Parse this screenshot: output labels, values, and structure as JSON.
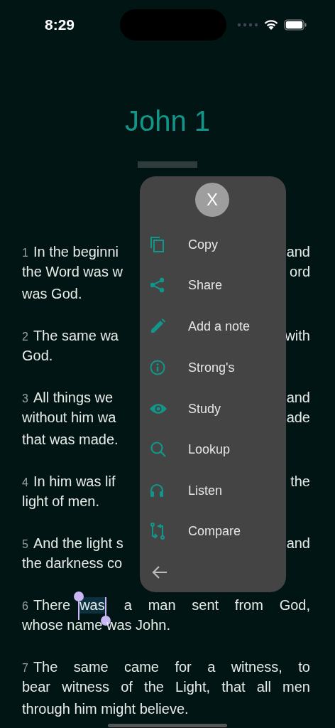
{
  "status_bar": {
    "time": "8:29"
  },
  "title": "John 1",
  "verses": [
    {
      "number": "1",
      "lines": [
        [
          {
            "text": "In the beginni",
            "selected": false
          },
          {
            "text": "and",
            "selected": false
          }
        ],
        [
          {
            "text": "the Word was w",
            "selected": false
          },
          {
            "text": "ord",
            "selected": false
          }
        ],
        [
          {
            "text": "was God.",
            "selected": false
          }
        ]
      ]
    },
    {
      "number": "2",
      "lines": [
        [
          {
            "text": "The same wa",
            "selected": false
          },
          {
            "text": "with",
            "selected": false
          }
        ],
        [
          {
            "text": "God.",
            "selected": false
          }
        ]
      ]
    },
    {
      "number": "3",
      "lines": [
        [
          {
            "text": "All things we",
            "selected": false
          },
          {
            "text": "and",
            "selected": false
          }
        ],
        [
          {
            "text": "without him wa",
            "selected": false
          },
          {
            "text": "ade",
            "selected": false
          }
        ],
        [
          {
            "text": "that was made.",
            "selected": false
          }
        ]
      ]
    },
    {
      "number": "4",
      "lines": [
        [
          {
            "text": "In him was lif",
            "selected": false
          },
          {
            "text": "the",
            "selected": false
          }
        ],
        [
          {
            "text": "light of men.",
            "selected": false
          }
        ]
      ]
    },
    {
      "number": "5",
      "lines": [
        [
          {
            "text": "And the light s",
            "selected": false
          },
          {
            "text": "and",
            "selected": false
          }
        ],
        [
          {
            "text": "the darkness co",
            "selected": false
          }
        ]
      ]
    },
    {
      "number": "6",
      "lines": [
        [
          {
            "text": "There",
            "selected": false
          },
          {
            "text": "was",
            "selected": true
          },
          {
            "text": "a man sent from God,",
            "selected": false
          }
        ],
        [
          {
            "text": "whose name was John.",
            "selected": false
          }
        ]
      ]
    },
    {
      "number": "7",
      "lines": [
        [
          {
            "text": "The same came for a witness, to",
            "selected": false
          }
        ],
        [
          {
            "text": "bear witness of the Light, that all men",
            "selected": false
          }
        ],
        [
          {
            "text": "through him might believe.",
            "selected": false
          }
        ]
      ]
    }
  ],
  "menu": {
    "close": "X",
    "items": [
      {
        "label": "Copy"
      },
      {
        "label": "Share"
      },
      {
        "label": "Add a note"
      },
      {
        "label": "Strong's"
      },
      {
        "label": "Study"
      },
      {
        "label": "Lookup"
      },
      {
        "label": "Listen"
      },
      {
        "label": "Compare"
      }
    ]
  }
}
